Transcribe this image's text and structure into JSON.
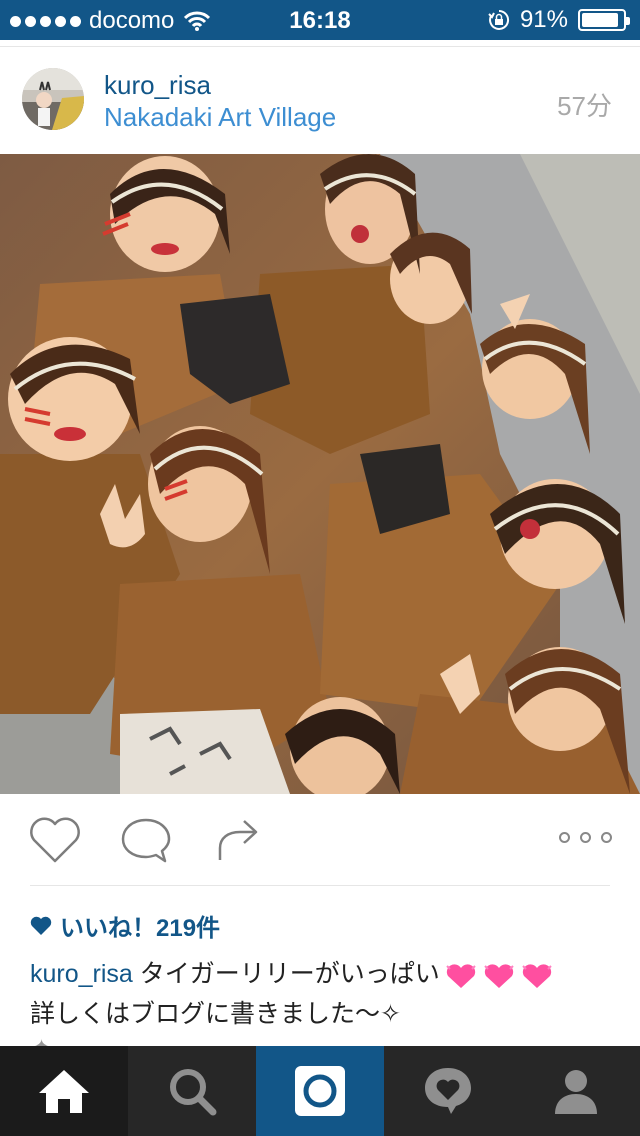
{
  "status_bar": {
    "carrier": "docomo",
    "time": "16:18",
    "battery": "91%",
    "battery_level": 0.91
  },
  "post": {
    "username": "kuro_risa",
    "location": "Nakadaki Art Village",
    "time_ago": "57分",
    "likes": "いいね！219件",
    "caption_user": "kuro_risa",
    "caption_text": " タイガーリリーがいっぱい",
    "caption_line2": "詳しくはブログに書きました〜✧"
  },
  "icons": {
    "signal": "signal-dots-icon",
    "wifi": "wifi-icon",
    "lock": "rotation-lock-icon",
    "battery": "battery-icon",
    "like": "heart-outline-icon",
    "comment": "comment-bubble-icon",
    "share": "share-arrow-icon",
    "more": "more-dots-icon",
    "likes_heart": "heart-filled-icon",
    "caption_emoji": "sparkling-heart-emoji",
    "tab_home": "home-icon",
    "tab_search": "search-icon",
    "tab_camera": "camera-icon",
    "tab_activity": "activity-heart-icon",
    "tab_profile": "profile-icon"
  },
  "colors": {
    "status_bar_bg": "#125688",
    "username": "#125688",
    "location": "#3d8ed2",
    "tab_bar_bg": "#272727",
    "tab_active_bg": "#125688",
    "heart_emoji": "#ff4fa0"
  }
}
